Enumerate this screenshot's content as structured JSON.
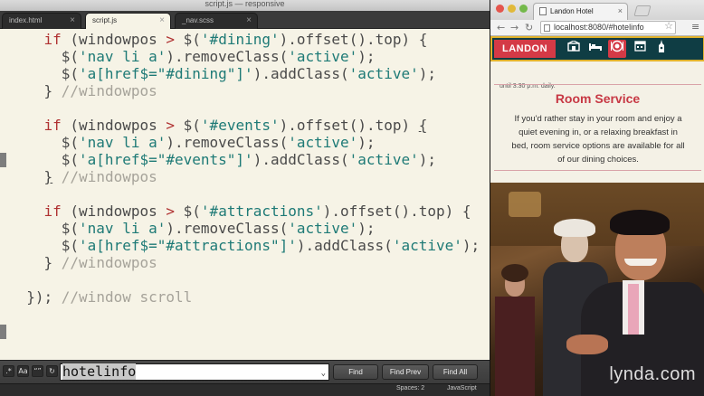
{
  "editor": {
    "window_title": "script.js — responsive",
    "tabs": [
      {
        "label": "index.html",
        "active": false
      },
      {
        "label": "script.js",
        "active": true
      },
      {
        "label": "_nav.scss",
        "active": false
      }
    ],
    "find": {
      "query": "hotelinfo",
      "buttons": [
        "Find",
        "Find Prev",
        "Find All"
      ]
    },
    "status": {
      "indent": "Spaces: 2",
      "syntax": "JavaScript"
    }
  },
  "code_lines": [
    {
      "indent": 4,
      "tokens": [
        [
          "kw",
          "if"
        ],
        [
          "pn",
          " (windowpos "
        ],
        [
          "op",
          ">"
        ],
        [
          "pn",
          " $("
        ],
        [
          "str",
          "'#dining'"
        ],
        [
          "pn",
          ").offset().top) {"
        ]
      ]
    },
    {
      "indent": 6,
      "tokens": [
        [
          "pn",
          "$("
        ],
        [
          "str",
          "'nav li a'"
        ],
        [
          "pn",
          ").removeClass("
        ],
        [
          "str",
          "'active'"
        ],
        [
          "pn",
          ");"
        ]
      ]
    },
    {
      "indent": 6,
      "tokens": [
        [
          "pn",
          "$("
        ],
        [
          "str",
          "'a[href$=\"#dining\"]'"
        ],
        [
          "pn",
          ").addClass("
        ],
        [
          "str",
          "'active'"
        ],
        [
          "pn",
          ");"
        ]
      ]
    },
    {
      "indent": 4,
      "tokens": [
        [
          "pn",
          "} "
        ],
        [
          "cm",
          "//windowpos"
        ]
      ]
    },
    {
      "indent": 0,
      "tokens": []
    },
    {
      "indent": 4,
      "tokens": [
        [
          "kw",
          "if"
        ],
        [
          "pn",
          " (windowpos "
        ],
        [
          "op",
          ">"
        ],
        [
          "pn",
          " $("
        ],
        [
          "str",
          "'#events'"
        ],
        [
          "pn",
          ").offset().top) "
        ],
        [
          "u",
          "{"
        ]
      ]
    },
    {
      "indent": 6,
      "tokens": [
        [
          "pn",
          "$("
        ],
        [
          "str",
          "'nav li a'"
        ],
        [
          "pn",
          ").removeClass("
        ],
        [
          "str",
          "'active'"
        ],
        [
          "pn",
          ");"
        ]
      ]
    },
    {
      "indent": 6,
      "tokens": [
        [
          "pn",
          "$("
        ],
        [
          "str",
          "'a[href$=\"#events\"]'"
        ],
        [
          "pn",
          ").addClass("
        ],
        [
          "str",
          "'active'"
        ],
        [
          "pn",
          ");"
        ]
      ]
    },
    {
      "indent": 4,
      "tokens": [
        [
          "u",
          "}"
        ],
        [
          "pn",
          " "
        ],
        [
          "cm",
          "//windowpos"
        ]
      ]
    },
    {
      "indent": 0,
      "tokens": []
    },
    {
      "indent": 4,
      "tokens": [
        [
          "kw",
          "if"
        ],
        [
          "pn",
          " (windowpos "
        ],
        [
          "op",
          ">"
        ],
        [
          "pn",
          " $("
        ],
        [
          "str",
          "'#attractions'"
        ],
        [
          "pn",
          ").offset().top) {"
        ]
      ]
    },
    {
      "indent": 6,
      "tokens": [
        [
          "pn",
          "$("
        ],
        [
          "str",
          "'nav li a'"
        ],
        [
          "pn",
          ").removeClass("
        ],
        [
          "str",
          "'active'"
        ],
        [
          "pn",
          ");"
        ]
      ]
    },
    {
      "indent": 6,
      "tokens": [
        [
          "pn",
          "$("
        ],
        [
          "str",
          "'a[href$=\"#attractions\"]'"
        ],
        [
          "pn",
          ").addClass("
        ],
        [
          "str",
          "'active'"
        ],
        [
          "pn",
          ");"
        ]
      ]
    },
    {
      "indent": 4,
      "tokens": [
        [
          "pn",
          "} "
        ],
        [
          "cm",
          "//windowpos"
        ]
      ]
    },
    {
      "indent": 0,
      "tokens": []
    },
    {
      "indent": 2,
      "tokens": [
        [
          "pn",
          "}); "
        ],
        [
          "cm",
          "//window scroll"
        ]
      ]
    }
  ],
  "browser": {
    "tab_title": "Landon Hotel",
    "url": "localhost:8080/#hotelinfo",
    "site": {
      "brand": "LANDON",
      "nav_icons": [
        "building-icon",
        "bed-icon",
        "dining-icon",
        "calendar-icon",
        "attractions-icon"
      ],
      "active_nav_index": 2,
      "partial_text": "until 3:30 p.m. daily.",
      "section_title": "Room Service",
      "section_body": "If you'd rather stay in your room and enjoy a quiet evening in, or a relaxing breakfast in bed, room service options are available for all of our dining choices."
    },
    "watermark": "lynda.com"
  }
}
